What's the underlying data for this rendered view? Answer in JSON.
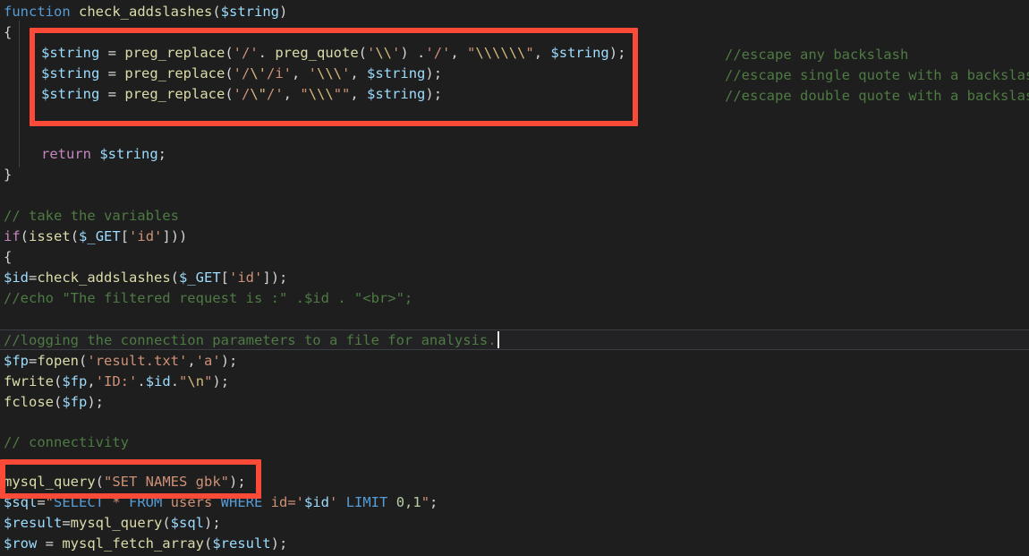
{
  "editor": {
    "language": "php",
    "background_color": "#1e1e1e",
    "foreground_color": "#d4d4d4",
    "annotation_color": "#fb4b38",
    "caret_color": "#e8e8e8"
  },
  "code_lines": {
    "l1_function": "function ",
    "l1_name": "check_addslashes",
    "l1_paren_open": "(",
    "l1_arg": "$string",
    "l1_paren_close": ")",
    "l2_brace": "{",
    "l3_var": "$string",
    "l3_eq": " = ",
    "l3_fn": "preg_replace",
    "l3_open": "(",
    "l3_s1": "'/'",
    "l3_dot1": ". ",
    "l3_fn2": "preg_quote",
    "l3_open2": "(",
    "l3_s2a": "'",
    "l3_s2b": "\\\\",
    "l3_s2c": "'",
    "l3_close2": ")",
    "l3_dot2": " .",
    "l3_s3": "'/'",
    "l3_comma1": ", ",
    "l3_s4a": "\"",
    "l3_s4b": "\\\\\\\\\\\\",
    "l3_s4c": "\"",
    "l3_comma2": ", ",
    "l3_var2": "$string",
    "l3_end": ");",
    "l4_var": "$string",
    "l4_eq": " = ",
    "l4_fn": "preg_replace",
    "l4_open": "(",
    "l4_s1a": "'/",
    "l4_s1b": "\\'",
    "l4_s1c": "/i'",
    "l4_comma1": ", ",
    "l4_s2a": "'",
    "l4_s2b": "\\\\\\",
    "l4_s2c": "'",
    "l4_comma2": ", ",
    "l4_var2": "$string",
    "l4_end": ");",
    "l5_var": "$string",
    "l5_eq": " = ",
    "l5_fn": "preg_replace",
    "l5_open": "(",
    "l5_s1a": "'/",
    "l5_s1b": "\\\"",
    "l5_s1c": "/'",
    "l5_comma1": ", ",
    "l5_s2a": "\"",
    "l5_s2b": "\\\\\\",
    "l5_s2c": "\"\"",
    "l5_comma2": ", ",
    "l5_var2": "$string",
    "l5_end": ");",
    "l7_return": "return ",
    "l7_var": "$string",
    "l7_semi": ";",
    "l8_brace": "}",
    "l10_comment": "// take the variables",
    "l11_if": "if",
    "l11_open": "(",
    "l11_fn": "isset",
    "l11_open2": "(",
    "l11_var": "$_GET",
    "l11_bracket1": "[",
    "l11_key": "'id'",
    "l11_bracket2": "]",
    "l11_close": "))",
    "l12_brace": "{",
    "l13_var": "$id",
    "l13_eq": "=",
    "l13_fn": "check_addslashes",
    "l13_open": "(",
    "l13_var2": "$_GET",
    "l13_b1": "[",
    "l13_key": "'id'",
    "l13_b2": "]",
    "l13_end": ");",
    "l14_comment": "//echo \"The filtered request is :\" .$id . \"<br>\";",
    "l16_comment": "//logging the connection parameters to a file for analysis.",
    "l17_var": "$fp",
    "l17_eq": "=",
    "l17_fn": "fopen",
    "l17_open": "(",
    "l17_s1": "'result.txt'",
    "l17_comma": ",",
    "l17_s2": "'a'",
    "l17_end": ");",
    "l18_fn": "fwrite",
    "l18_open": "(",
    "l18_var": "$fp",
    "l18_comma1": ",",
    "l18_s1": "'ID:'",
    "l18_dot1": ".",
    "l18_var2": "$id",
    "l18_dot2": ".",
    "l18_s2a": "\"",
    "l18_s2b": "\\n",
    "l18_s2c": "\"",
    "l18_end": ");",
    "l19_fn": "fclose",
    "l19_open": "(",
    "l19_var": "$fp",
    "l19_end": ");",
    "l21_comment": "// connectivity",
    "l22_fn": "mysql_query",
    "l22_open": "(",
    "l22_str": "\"SET NAMES gbk\"",
    "l22_end": ");",
    "l23_var": "$sql",
    "l23_eq": "=",
    "l23_q1": "\"",
    "l23_sel": "SELECT",
    "l23_star": " * ",
    "l23_from": "FROM",
    "l23_tbl": " users ",
    "l23_where": "WHERE",
    "l23_col": " id=",
    "l23_q2": "'",
    "l23_idvar": "$id",
    "l23_q3": "'",
    "l23_limit": " LIMIT ",
    "l23_nums": "0,1",
    "l23_q4": "\"",
    "l23_semi": ";",
    "l24_var": "$result",
    "l24_eq": "=",
    "l24_fn": "mysql_query",
    "l24_open": "(",
    "l24_var2": "$sql",
    "l24_end": ");",
    "l25_var": "$row",
    "l25_eq": " = ",
    "l25_fn": "mysql_fetch_array",
    "l25_open": "(",
    "l25_var2": "$result",
    "l25_end": ");"
  },
  "right_comments": [
    "//escape any backslash",
    "//escape single quote with a backslash",
    "//escape double quote with a backslash"
  ],
  "annotations": [
    {
      "name": "preg-replace-block-highlight",
      "note": "red rectangle around the three preg_replace lines"
    },
    {
      "name": "set-names-gbk-highlight",
      "note": "red rectangle around mysql_query(\"SET NAMES gbk\");"
    }
  ]
}
